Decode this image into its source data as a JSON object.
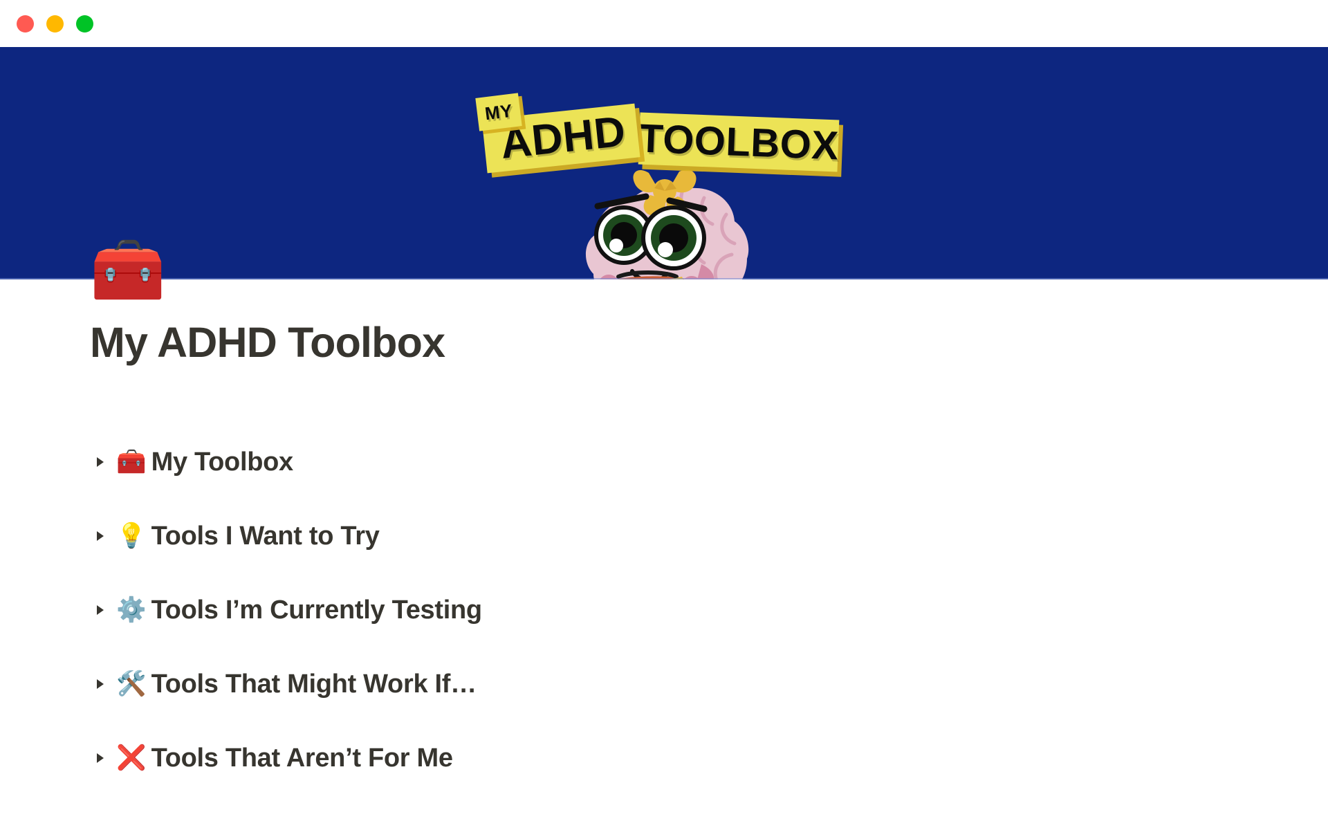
{
  "window": {
    "controls": [
      {
        "name": "close",
        "color": "#ff5a52"
      },
      {
        "name": "minimize",
        "color": "#ffb800"
      },
      {
        "name": "zoom",
        "color": "#00c326"
      }
    ]
  },
  "cover": {
    "background_color": "#0d2680",
    "logo": {
      "sticker_color": "#ece356",
      "shadow_color": "#d6b020",
      "text_color": "#0b0b0b",
      "word_my": "MY",
      "word_adhd": "ADHD",
      "word_toolbox": "TOOLBOX"
    },
    "mascot": {
      "name": "brain-with-toolbox-illustration",
      "brain_color": "#e9c6d2",
      "brain_shade": "#d9a3b8",
      "bow_color": "#e8b93a",
      "toolbox_color": "#c85b32",
      "eye_color": "#1e4a1e"
    }
  },
  "page": {
    "icon": "🧰",
    "icon_name": "toolbox-emoji",
    "title": "My ADHD Toolbox",
    "title_color": "#37352f"
  },
  "toggles": [
    {
      "emoji": "🧰",
      "icon_name": "toolbox-emoji",
      "label": "My Toolbox",
      "expanded": false
    },
    {
      "emoji": "💡",
      "icon_name": "light-bulb-emoji",
      "label": "Tools I Want to Try",
      "expanded": false
    },
    {
      "emoji": "⚙️",
      "icon_name": "gear-emoji",
      "label": "Tools I’m Currently Testing",
      "expanded": false
    },
    {
      "emoji": "🛠️",
      "icon_name": "hammer-and-wrench-emoji",
      "label": "Tools That Might Work If…",
      "expanded": false
    },
    {
      "emoji": "❌",
      "icon_name": "cross-mark-emoji",
      "label": "Tools That Aren’t For Me",
      "expanded": false
    }
  ]
}
